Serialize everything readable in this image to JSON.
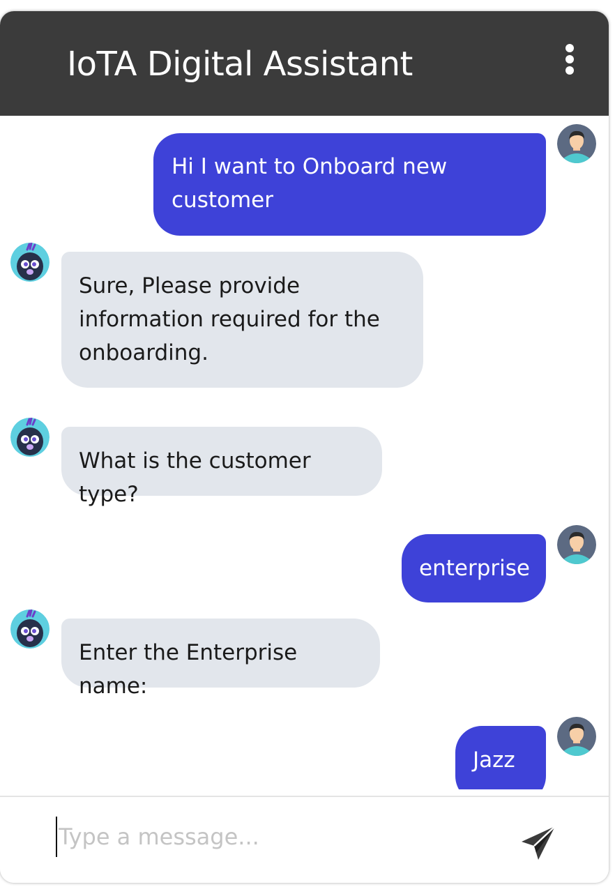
{
  "header": {
    "title": "IoTA Digital Assistant",
    "menu_icon": "vertical-ellipsis-icon"
  },
  "messages": [
    {
      "sender": "user",
      "text": "Hi I want to Onboard new\ncustomer"
    },
    {
      "sender": "bot",
      "text": "Sure, Please provide\ninformation required for the\nonboarding."
    },
    {
      "sender": "bot",
      "text": "What is the customer type?"
    },
    {
      "sender": "user",
      "text": "enterprise"
    },
    {
      "sender": "bot",
      "text": "Enter the Enterprise name:"
    },
    {
      "sender": "user",
      "text": "Jazz"
    }
  ],
  "input": {
    "placeholder": "Type a message...",
    "value": ""
  },
  "icons": {
    "send": "paper-plane-send-icon",
    "user_avatar": "user-avatar-icon",
    "bot_avatar": "bot-avatar-icon"
  },
  "colors": {
    "header_bg": "#3b3b3b",
    "user_bubble": "#3e42d8",
    "bot_bubble": "#e2e6ec",
    "bot_avatar_bg": "#5ecfe0",
    "user_avatar_bg": "#5c6a82"
  }
}
